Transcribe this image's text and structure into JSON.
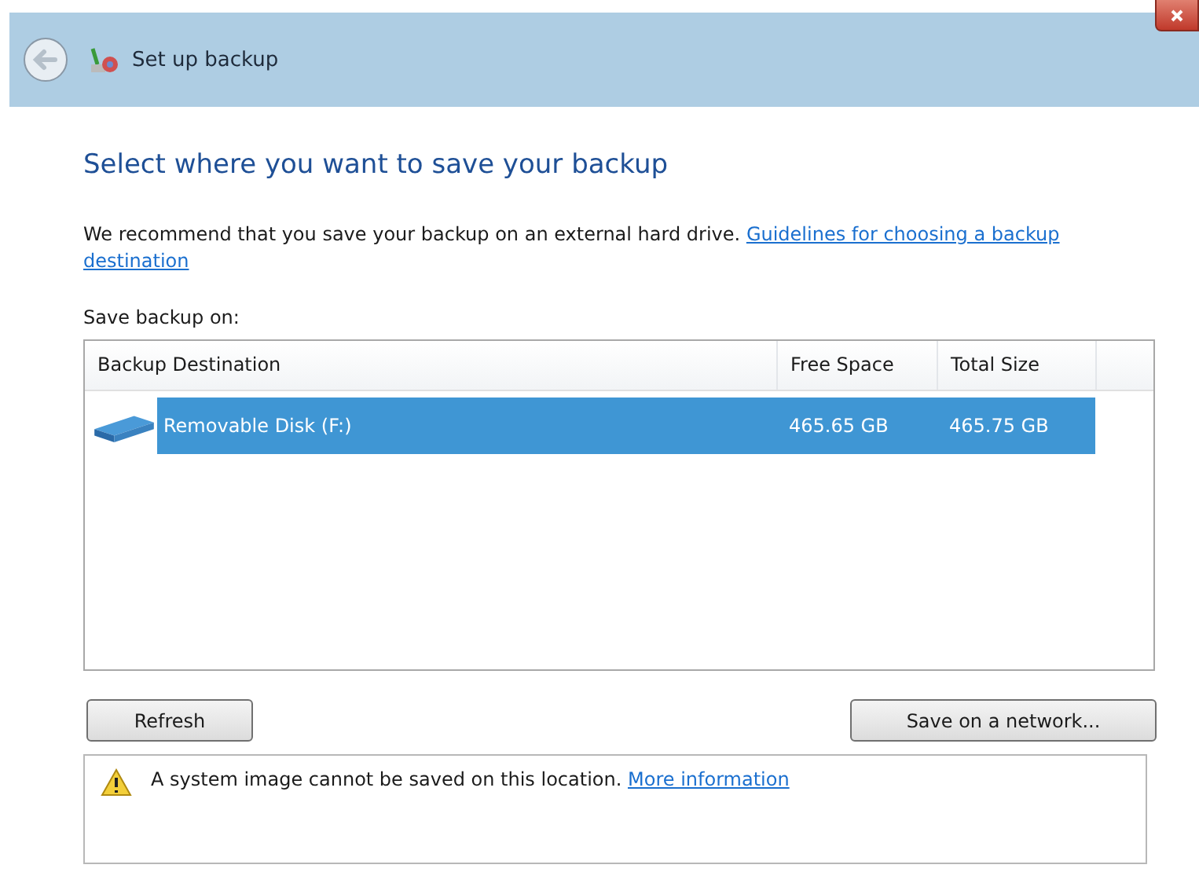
{
  "window": {
    "title": "Set up backup"
  },
  "heading": "Select where you want to save your backup",
  "intro": {
    "text": "We recommend that you save your backup on an external hard drive.",
    "link_lines": [
      "Guidelines for choosing a backup",
      "destination"
    ]
  },
  "list_label": "Save backup on:",
  "table": {
    "columns": [
      "Backup Destination",
      "Free Space",
      "Total Size"
    ],
    "rows": [
      {
        "name": "Removable Disk (F:)",
        "free": "465.65 GB",
        "total": "465.75 GB",
        "selected": true
      }
    ]
  },
  "buttons": {
    "refresh": "Refresh",
    "network": "Save on a network..."
  },
  "message": {
    "text": "A system image cannot be saved on this location.",
    "link": "More information"
  }
}
